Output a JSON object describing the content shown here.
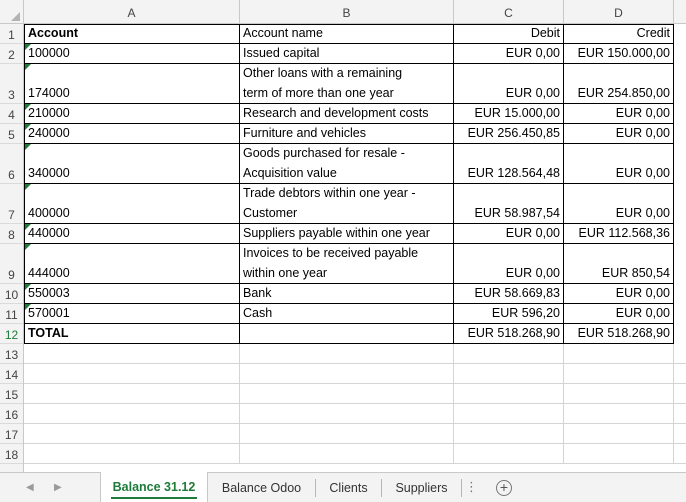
{
  "columns": [
    "A",
    "B",
    "C",
    "D"
  ],
  "row_numbers": [
    "1",
    "2",
    "3",
    "4",
    "5",
    "6",
    "7",
    "8",
    "9",
    "10",
    "11",
    "12",
    "13",
    "14",
    "15",
    "16",
    "17",
    "18"
  ],
  "rows": [
    {
      "cells": [
        "Account",
        "Account name",
        "Debit",
        "Credit"
      ],
      "header": true
    },
    {
      "cells": [
        "100000",
        "Issued capital",
        "EUR 0,00",
        "EUR 150.000,00"
      ]
    },
    {
      "cells": [
        "174000",
        "Other loans with a remaining\nterm of more than one year",
        "EUR 0,00",
        "EUR 254.850,00"
      ]
    },
    {
      "cells": [
        "210000",
        "Research and development costs",
        "EUR 15.000,00",
        "EUR 0,00"
      ]
    },
    {
      "cells": [
        "240000",
        "Furniture and vehicles",
        "EUR 256.450,85",
        "EUR 0,00"
      ]
    },
    {
      "cells": [
        "340000",
        "Goods purchased for resale -\nAcquisition value",
        "EUR 128.564,48",
        "EUR 0,00"
      ]
    },
    {
      "cells": [
        "400000",
        "Trade debtors within one year -\nCustomer",
        "EUR 58.987,54",
        "EUR 0,00"
      ]
    },
    {
      "cells": [
        "440000",
        "Suppliers payable within one year",
        "EUR 0,00",
        "EUR 112.568,36"
      ]
    },
    {
      "cells": [
        "444000",
        "Invoices to be received payable\nwithin one year",
        "EUR 0,00",
        "EUR 850,54"
      ]
    },
    {
      "cells": [
        "550003",
        "Bank",
        "EUR 58.669,83",
        "EUR 0,00"
      ]
    },
    {
      "cells": [
        "570001",
        "Cash",
        "EUR 596,20",
        "EUR 0,00"
      ]
    },
    {
      "cells": [
        "TOTAL",
        "",
        "EUR 518.268,90",
        "EUR 518.268,90"
      ],
      "total": true
    }
  ],
  "tabs": [
    {
      "label": "Balance 31.12",
      "active": true
    },
    {
      "label": "Balance Odoo",
      "active": false
    },
    {
      "label": "Clients",
      "active": false
    },
    {
      "label": "Suppliers",
      "active": false
    }
  ],
  "icons": {
    "nav_prev": "triangle-left-icon",
    "nav_next": "triangle-right-icon",
    "more": "ellipsis-icon",
    "add_sheet": "plus-circle-icon",
    "select_all": "corner-triangle-icon"
  },
  "colors": {
    "accent": "#1e7b3a",
    "header_bg": "#f3f3f3",
    "grid_line": "#d4d4d4"
  },
  "glyphs": {
    "prev": "◀",
    "next": "▶",
    "more": "⋮",
    "add": "+"
  }
}
